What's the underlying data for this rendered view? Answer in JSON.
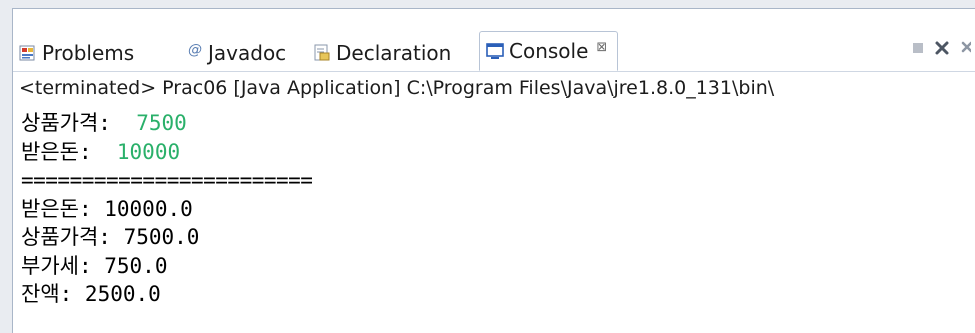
{
  "tabs": {
    "problems_label": "Problems",
    "javadoc_label": "Javadoc",
    "declaration_label": "Declaration",
    "console_label": "Console",
    "console_close": "⊠"
  },
  "console": {
    "header": "<terminated> Prac06 [Java Application] C:\\Program Files\\Java\\jre1.8.0_131\\bin\\",
    "lines": [
      {
        "label": "상품가격:  ",
        "value": "7500"
      },
      {
        "label": "받은돈:  ",
        "value": "10000"
      },
      {
        "text": "========================"
      },
      {
        "text": "받은돈: 10000.0"
      },
      {
        "text": "상품가격: 7500.0"
      },
      {
        "text": "부가세: 750.0"
      },
      {
        "text": "잔액: 2500.0"
      }
    ]
  },
  "colors": {
    "input_text": "#2ab06a",
    "accent_blue": "#2b5fb8"
  },
  "icons": {
    "problems": "problems-icon",
    "javadoc": "at-sign-icon",
    "declaration": "declaration-icon",
    "console": "console-icon",
    "terminate": "terminate-icon",
    "remove": "remove-launch-icon",
    "remove_all": "remove-all-icon"
  }
}
